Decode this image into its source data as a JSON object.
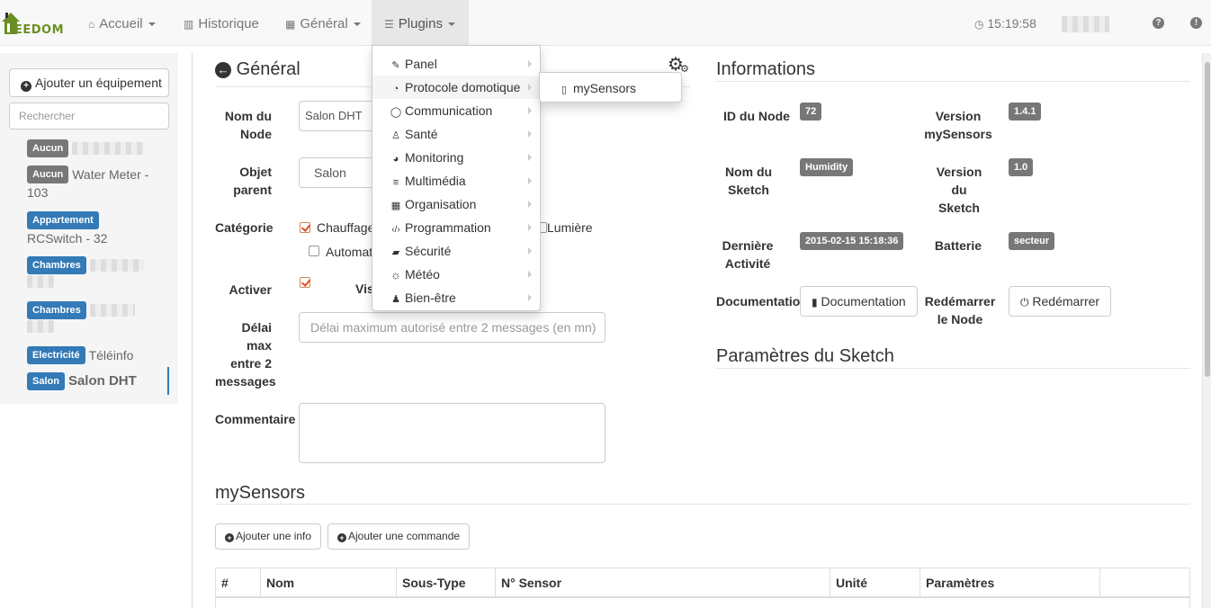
{
  "brand": {
    "text": "EEDOM",
    "logo_letter": "J"
  },
  "nav": {
    "items": [
      {
        "label": "Accueil",
        "icon": "home-icon",
        "glyph": "⌂"
      },
      {
        "label": "Historique",
        "icon": "bar-chart-icon",
        "glyph": "▥"
      },
      {
        "label": "Général",
        "icon": "grid-icon",
        "glyph": "▦"
      },
      {
        "label": "Plugins",
        "icon": "list-icon",
        "glyph": "☰"
      }
    ],
    "time": "15:19:58",
    "help_glyph": "?",
    "alert_glyph": "!"
  },
  "sidebar": {
    "add_button": "Ajouter un équipement",
    "search_placeholder": "Rechercher",
    "items": [
      {
        "tag": "Aucun",
        "name": ""
      },
      {
        "tag": "Aucun",
        "name": "Water Meter - 103"
      },
      {
        "tag": "Appartement",
        "name": "RCSwitch - 32"
      },
      {
        "tag": "Chambres",
        "name": ""
      },
      {
        "tag": "Chambres",
        "name": ""
      },
      {
        "tag": "Electricité",
        "name": "Téléinfo"
      },
      {
        "tag": "Salon",
        "name": "Salon DHT"
      }
    ]
  },
  "general": {
    "title": "Général",
    "node_name_label": "Nom du Node",
    "node_name_value": "Salon DHT",
    "parent_label": "Objet parent",
    "parent_value": "Salon",
    "category_label": "Catégorie",
    "categories": {
      "chauffage": "Chauffage",
      "lumiere": "Lumière",
      "automatisme": "Automat"
    },
    "activate_label": "Activer",
    "visible_label": "Vis",
    "delay_label": "Délai max entre 2 messages",
    "delay_placeholder": "Délai maximum autorisé entre 2 messages (en mn)",
    "comment_label": "Commentaire"
  },
  "info": {
    "title": "Informations",
    "node_id_label": "ID du Node",
    "node_id_value": "72",
    "mysensors_version_label": "Version mySensors",
    "mysensors_version_value": "1.4.1",
    "sketch_name_label": "Nom du Sketch",
    "sketch_name_value": "Humidity",
    "sketch_version_label": "Version du Sketch",
    "sketch_version_value": "1.0",
    "last_activity_label": "Dernière Activité",
    "last_activity_value": "2015-02-15 15:18:36",
    "battery_label": "Batterie",
    "battery_value": "secteur",
    "doc_label": "Documentatio",
    "doc_button": "Documentation",
    "restart_label": "Redémarrer le Node",
    "restart_button": "Redémarrer",
    "sketch_params_title": "Paramètres du Sketch"
  },
  "mysensors": {
    "title": "mySensors",
    "add_info_button": "Ajouter une info",
    "add_command_button": "Ajouter une commande",
    "columns": [
      "#",
      "Nom",
      "Sous-Type",
      "N° Sensor",
      "Unité",
      "Paramètres",
      ""
    ]
  },
  "plugins_menu": {
    "items": [
      {
        "label": "Panel",
        "icon": "pin-icon",
        "glyph": "✎"
      },
      {
        "label": "Protocole domotique",
        "icon": "rss-icon",
        "glyph": "◔"
      },
      {
        "label": "Communication",
        "icon": "comment-icon",
        "glyph": "◯"
      },
      {
        "label": "Santé",
        "icon": "running-icon",
        "glyph": "♙"
      },
      {
        "label": "Monitoring",
        "icon": "dashboard-icon",
        "glyph": "◕"
      },
      {
        "label": "Multimédia",
        "icon": "sliders-icon",
        "glyph": "≡"
      },
      {
        "label": "Organisation",
        "icon": "calendar-icon",
        "glyph": "▦"
      },
      {
        "label": "Programmation",
        "icon": "code-icon",
        "glyph": "‹/›"
      },
      {
        "label": "Sécurité",
        "icon": "lock-icon",
        "glyph": "▰"
      },
      {
        "label": "Météo",
        "icon": "sun-icon",
        "glyph": "☼"
      },
      {
        "label": "Bien-être",
        "icon": "user-icon",
        "glyph": "♟"
      }
    ],
    "submenu": [
      {
        "label": "mySensors",
        "icon": "mobile-icon",
        "glyph": "▯"
      }
    ]
  },
  "colors": {
    "accent": "#337ab7",
    "tag_gray": "#777777",
    "brand_green": "#6a8e23"
  }
}
